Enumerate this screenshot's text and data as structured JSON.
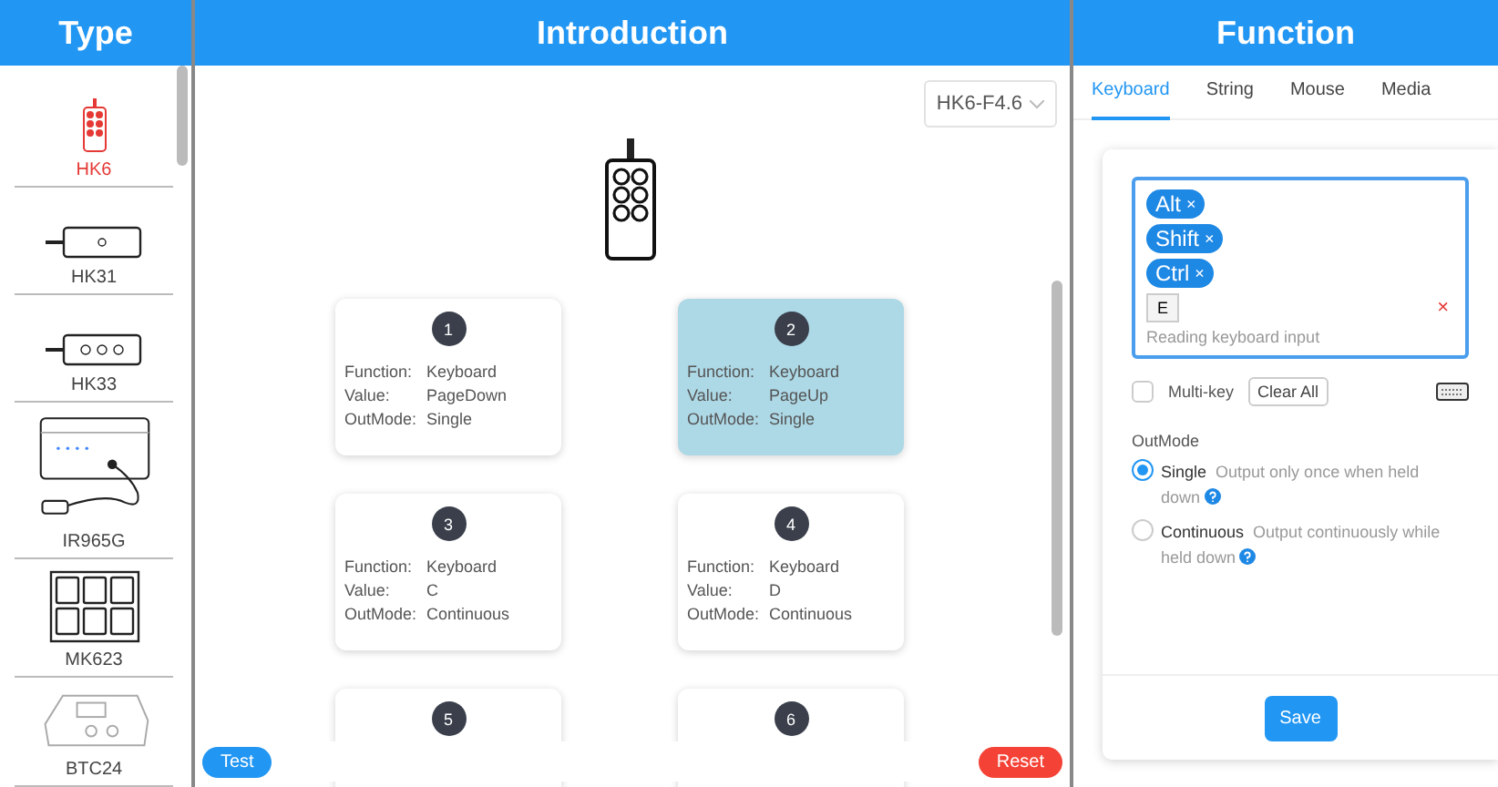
{
  "sidebar": {
    "title": "Type",
    "items": [
      {
        "label": "HK6",
        "kind": "remote",
        "selected": true
      },
      {
        "label": "HK31",
        "kind": "one-button",
        "selected": false
      },
      {
        "label": "HK33",
        "kind": "three-button",
        "selected": false
      },
      {
        "label": "IR965G",
        "kind": "box",
        "selected": false
      },
      {
        "label": "MK623",
        "kind": "pad",
        "selected": false
      },
      {
        "label": "BTC24",
        "kind": "hub",
        "selected": false
      }
    ]
  },
  "introduction": {
    "title": "Introduction",
    "model": "HK6-F4.6",
    "buttons": [
      {
        "number": "1",
        "selected": false,
        "fields": [
          {
            "label": "Function:",
            "value": "Keyboard"
          },
          {
            "label": "Value:",
            "value": "PageDown"
          },
          {
            "label": "OutMode:",
            "value": "Single"
          }
        ]
      },
      {
        "number": "2",
        "selected": true,
        "fields": [
          {
            "label": "Function:",
            "value": "Keyboard"
          },
          {
            "label": "Value:",
            "value": "PageUp"
          },
          {
            "label": "OutMode:",
            "value": "Single"
          }
        ]
      },
      {
        "number": "3",
        "selected": false,
        "fields": [
          {
            "label": "Function:",
            "value": "Keyboard"
          },
          {
            "label": "Value:",
            "value": "C"
          },
          {
            "label": "OutMode:",
            "value": "Continuous"
          }
        ]
      },
      {
        "number": "4",
        "selected": false,
        "fields": [
          {
            "label": "Function:",
            "value": "Keyboard"
          },
          {
            "label": "Value:",
            "value": "D"
          },
          {
            "label": "OutMode:",
            "value": "Continuous"
          }
        ]
      },
      {
        "number": "5",
        "selected": false
      },
      {
        "number": "6",
        "selected": false
      }
    ],
    "test_button": "Test",
    "reset_button": "Reset"
  },
  "function": {
    "title": "Function",
    "tabs": [
      {
        "label": "Keyboard",
        "selected": true
      },
      {
        "label": "String",
        "selected": false
      },
      {
        "label": "Mouse",
        "selected": false
      },
      {
        "label": "Media",
        "selected": false
      }
    ],
    "modifiers": [
      {
        "label": "Alt",
        "remove": "×"
      },
      {
        "label": "Shift",
        "remove": "×"
      },
      {
        "label": "Ctrl",
        "remove": "×"
      }
    ],
    "key": "E",
    "clear_icon": "×",
    "hint": "Reading keyboard input",
    "multi_key": {
      "label": "Multi-key",
      "checked": false
    },
    "clear_all": "Clear All",
    "outmode": {
      "title": "OutMode",
      "options": [
        {
          "label": "Single",
          "description": "Output only once when held down",
          "selected": true
        },
        {
          "label": "Continuous",
          "description": "Output continuously while held down",
          "selected": false
        }
      ]
    },
    "save": "Save"
  }
}
